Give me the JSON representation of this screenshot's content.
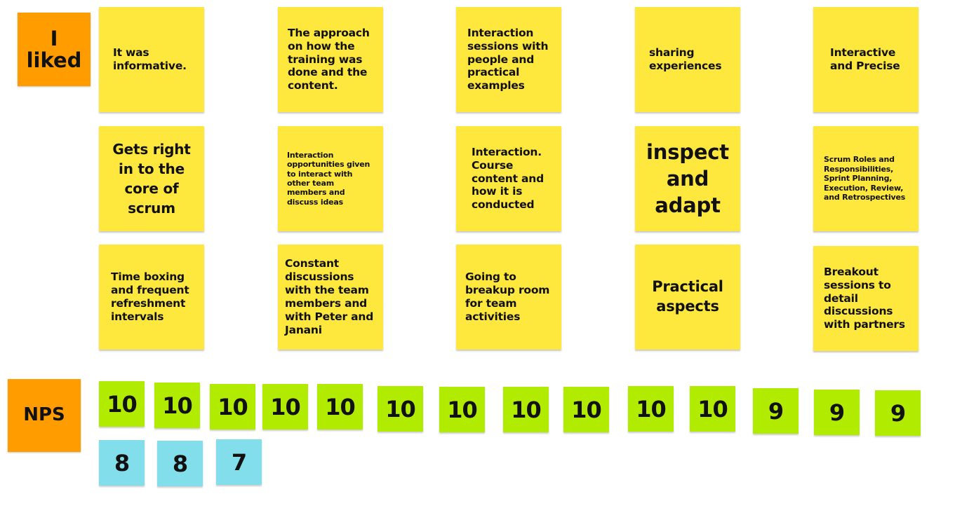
{
  "sections": {
    "liked": {
      "label": "I\nliked",
      "color": "#ff9d00"
    },
    "nps": {
      "label": "NPS",
      "color": "#ff9d00"
    }
  },
  "colors": {
    "note": "#ffe83d",
    "promoter": "#b0eb00",
    "passive": "#82deea"
  },
  "liked_notes": [
    "It was informative.",
    "The approach on how the training was done and the content.",
    "Interaction sessions with people and practical examples",
    "sharing experiences",
    "Interactive and Precise",
    "Gets right in to the core of scrum",
    "Interaction opportunities given to interact with other team members and discuss ideas",
    "Interaction. Course content and how it is conducted",
    "inspect and adapt",
    "Scrum Roles and Responsibilities, Sprint Planning, Execution, Review, and Retrospectives",
    "Time boxing and frequent refreshment intervals",
    "Constant discussions with the team members and with Peter and Janani",
    "Going to breakup room for team activities",
    "Practical aspects",
    "Breakout sessions to detail discussions with partners"
  ],
  "nps_scores": {
    "promoters": [
      "10",
      "10",
      "10",
      "10",
      "10",
      "10",
      "10",
      "10",
      "10",
      "10",
      "10",
      "9",
      "9",
      "9"
    ],
    "passives": [
      "8",
      "8",
      "7"
    ]
  }
}
